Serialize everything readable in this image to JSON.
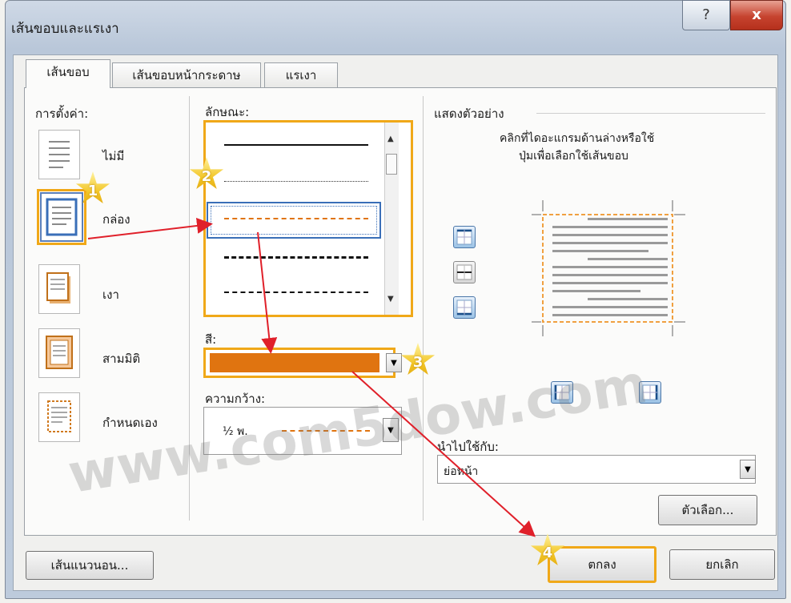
{
  "window": {
    "title": "เส้นขอบและแรเงา",
    "help": "?",
    "close": "x"
  },
  "tabs": [
    {
      "label": "เส้นขอบ",
      "active": true
    },
    {
      "label": "เส้นขอบหน้ากระดาษ",
      "active": false
    },
    {
      "label": "แรเงา",
      "active": false
    }
  ],
  "settings": {
    "heading": "การตั้งค่า:",
    "items": [
      {
        "label": "ไม่มี"
      },
      {
        "label": "กล่อง"
      },
      {
        "label": "เงา"
      },
      {
        "label": "สามมิติ"
      },
      {
        "label": "กำหนดเอง"
      }
    ]
  },
  "style": {
    "heading": "ลักษณะ:"
  },
  "color": {
    "heading": "สี:",
    "value": "#e07410"
  },
  "width": {
    "heading": "ความกว้าง:",
    "value": "½ พ."
  },
  "preview": {
    "heading": "แสดงตัวอย่าง",
    "hint_line1": "คลิกที่ไดอะแกรมด้านล่างหรือใช้",
    "hint_line2": "ปุ่มเพื่อเลือกใช้เส้นขอบ",
    "border_color": "#f0a040"
  },
  "apply_to": {
    "heading": "นำไปใช้กับ:",
    "value": "ย่อหน้า"
  },
  "buttons": {
    "options": "ตัวเลือก...",
    "horizontal_line": "เส้นแนวนอน...",
    "ok": "ตกลง",
    "cancel": "ยกเลิก"
  },
  "annotations": {
    "step1": "1",
    "step2": "2",
    "step3": "3",
    "step4": "4",
    "arrow_color": "#e0202a",
    "highlight_color": "#f0a818"
  },
  "watermark": "www.com5dow.com"
}
